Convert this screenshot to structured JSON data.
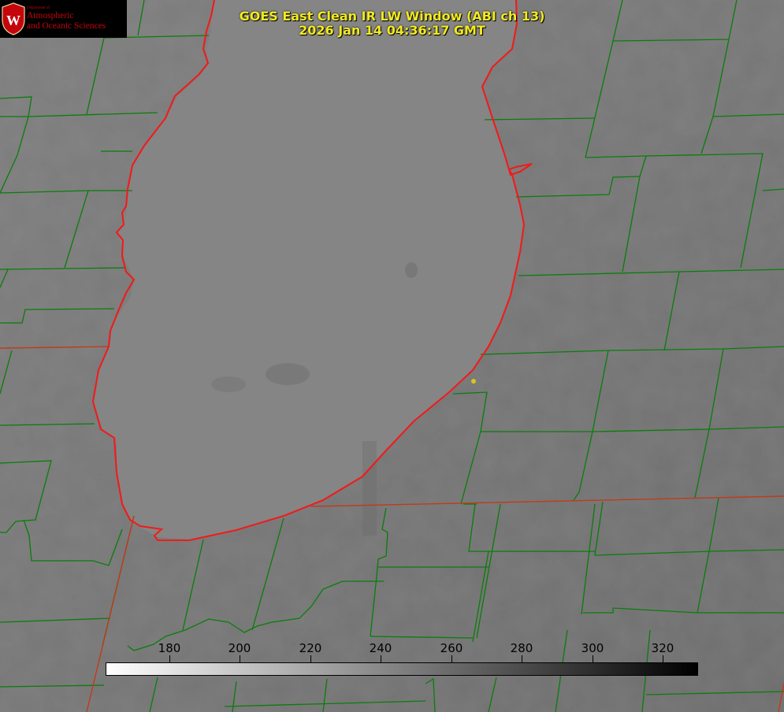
{
  "image": {
    "title": "GOES East Clean IR LW Window (ABI ch 13)",
    "timestamp": "2026 Jan 14 04:36:17 GMT"
  },
  "logo": {
    "small_text": "Department of",
    "line1": "Atmospheric",
    "line2": "and Oceanic Sciences",
    "seal_letter": "W"
  },
  "colorbar": {
    "ticks": [
      "180",
      "200",
      "220",
      "240",
      "260",
      "280",
      "300",
      "320"
    ],
    "range": [
      162,
      330
    ],
    "gradient": "white-to-black"
  },
  "colors": {
    "title": "#f2ea1e",
    "county_lines": "#0a7d0a",
    "state_lines": "#c23a1a",
    "coastline": "#ee1c1c",
    "brand_red": "#c5050c",
    "marker": "#d7c71c"
  }
}
